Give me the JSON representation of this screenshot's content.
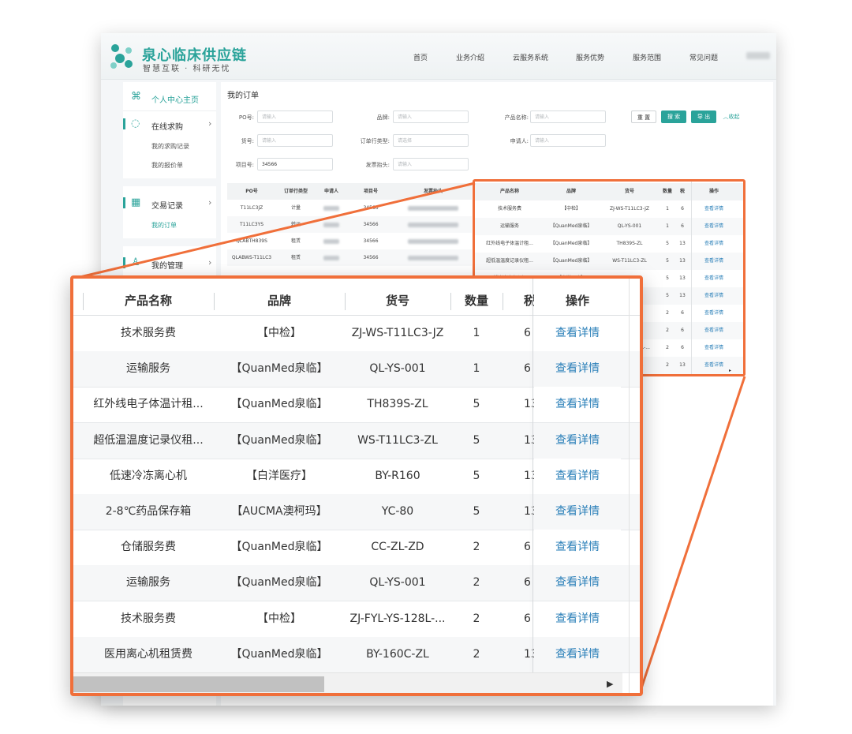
{
  "brand": {
    "title": "泉心临床供应链",
    "subtitle": "智慧互联 · 科研无忧"
  },
  "nav": [
    "首页",
    "业务介绍",
    "云服务系统",
    "服务优势",
    "服务范围",
    "常见问题"
  ],
  "sidebar": {
    "home": "个人中心主页",
    "groups": [
      {
        "label": "在线求购",
        "items": [
          "我的求购记录",
          "我的报价单"
        ]
      },
      {
        "label": "交易记录",
        "items": [
          "我的订单"
        ]
      },
      {
        "label": "我的管理",
        "items": []
      }
    ]
  },
  "main": {
    "title": "我的订单",
    "filters": {
      "po": {
        "label": "PO号:",
        "placeholder": "请输入"
      },
      "brand": {
        "label": "品牌:",
        "placeholder": "请输入"
      },
      "product": {
        "label": "产品名称:",
        "placeholder": "请输入"
      },
      "sku": {
        "label": "货号:",
        "placeholder": "请输入"
      },
      "type": {
        "label": "订单行类型:",
        "placeholder": "请选择"
      },
      "applicant": {
        "label": "申请人:",
        "placeholder": "请输入"
      },
      "project": {
        "label": "项目号:",
        "value": "34566"
      },
      "invoice": {
        "label": "发票抬头:",
        "placeholder": "请输入"
      }
    },
    "buttons": {
      "reset": "重 置",
      "search": "搜 索",
      "export": "导 出",
      "collapse": "收起"
    }
  },
  "small_table": {
    "headers": [
      "PO号",
      "订单行类型",
      "申请人",
      "项目号",
      "发票抬头"
    ],
    "rows": [
      [
        "T11LC3JZ",
        "计量",
        "34566"
      ],
      [
        "T11LC3YS",
        "转运",
        "34566"
      ],
      [
        "QLABTH839S",
        "租赁",
        "34566"
      ],
      [
        "QLABWS-T11LC3",
        "租赁",
        "34566"
      ]
    ]
  },
  "mid_table": {
    "headers": [
      "产品名称",
      "品牌",
      "货号",
      "数量",
      "税",
      "操作"
    ],
    "rows": [
      [
        "技术服务费",
        "【中检】",
        "ZJ-WS-T11LC3-JZ",
        "1",
        "6",
        "查看详情"
      ],
      [
        "运输服务",
        "【QuanMed泉临】",
        "QL-YS-001",
        "1",
        "6",
        "查看详情"
      ],
      [
        "红外线电子体温计租...",
        "【QuanMed泉临】",
        "TH839S-ZL",
        "5",
        "13",
        "查看详情"
      ],
      [
        "超低温温度记录仪租...",
        "【QuanMed泉临】",
        "WS-T11LC3-ZL",
        "5",
        "13",
        "查看详情"
      ],
      [
        "低速冷冻离心机",
        "【白洋医疗】",
        "BY-R160",
        "5",
        "13",
        "查看详情"
      ],
      [
        "2-8℃药品保存箱",
        "【AUCMA澳柯玛】",
        "YC-80",
        "5",
        "13",
        "查看详情"
      ],
      [
        "仓储服务费",
        "【QuanMed泉临】",
        "CC-ZL-ZD",
        "2",
        "6",
        "查看详情"
      ],
      [
        "运输服务",
        "【QuanMed泉临】",
        "QL-YS-001",
        "2",
        "6",
        "查看详情"
      ],
      [
        "技术服务费",
        "【中检】",
        "ZJ-FYL-YS-128L-...",
        "2",
        "6",
        "查看详情"
      ],
      [
        "医用离心机租赁费",
        "【QuanMed泉临】",
        "BY-160C-ZL",
        "2",
        "13",
        "查看详情"
      ]
    ]
  },
  "zoom_table": {
    "headers": [
      "产品名称",
      "品牌",
      "货号",
      "数量",
      "税",
      "操作"
    ],
    "rows": [
      [
        "技术服务费",
        "【中检】",
        "ZJ-WS-T11LC3-JZ",
        "1",
        "6",
        "查看详情"
      ],
      [
        "运输服务",
        "【QuanMed泉临】",
        "QL-YS-001",
        "1",
        "6",
        "查看详情"
      ],
      [
        "红外线电子体温计租...",
        "【QuanMed泉临】",
        "TH839S-ZL",
        "5",
        "13",
        "查看详情"
      ],
      [
        "超低温温度记录仪租...",
        "【QuanMed泉临】",
        "WS-T11LC3-ZL",
        "5",
        "13",
        "查看详情"
      ],
      [
        "低速冷冻离心机",
        "【白洋医疗】",
        "BY-R160",
        "5",
        "13",
        "查看详情"
      ],
      [
        "2-8℃药品保存箱",
        "【AUCMA澳柯玛】",
        "YC-80",
        "5",
        "13",
        "查看详情"
      ],
      [
        "仓储服务费",
        "【QuanMed泉临】",
        "CC-ZL-ZD",
        "2",
        "6",
        "查看详情"
      ],
      [
        "运输服务",
        "【QuanMed泉临】",
        "QL-YS-001",
        "2",
        "6",
        "查看详情"
      ],
      [
        "技术服务费",
        "【中检】",
        "ZJ-FYL-YS-128L-...",
        "2",
        "6",
        "查看详情"
      ],
      [
        "医用离心机租赁费",
        "【QuanMed泉临】",
        "BY-160C-ZL",
        "2",
        "13",
        "查看详情"
      ]
    ]
  },
  "colors": {
    "accent": "#2aa39a",
    "highlight": "#f06f3a",
    "link": "#2a7fb8"
  }
}
